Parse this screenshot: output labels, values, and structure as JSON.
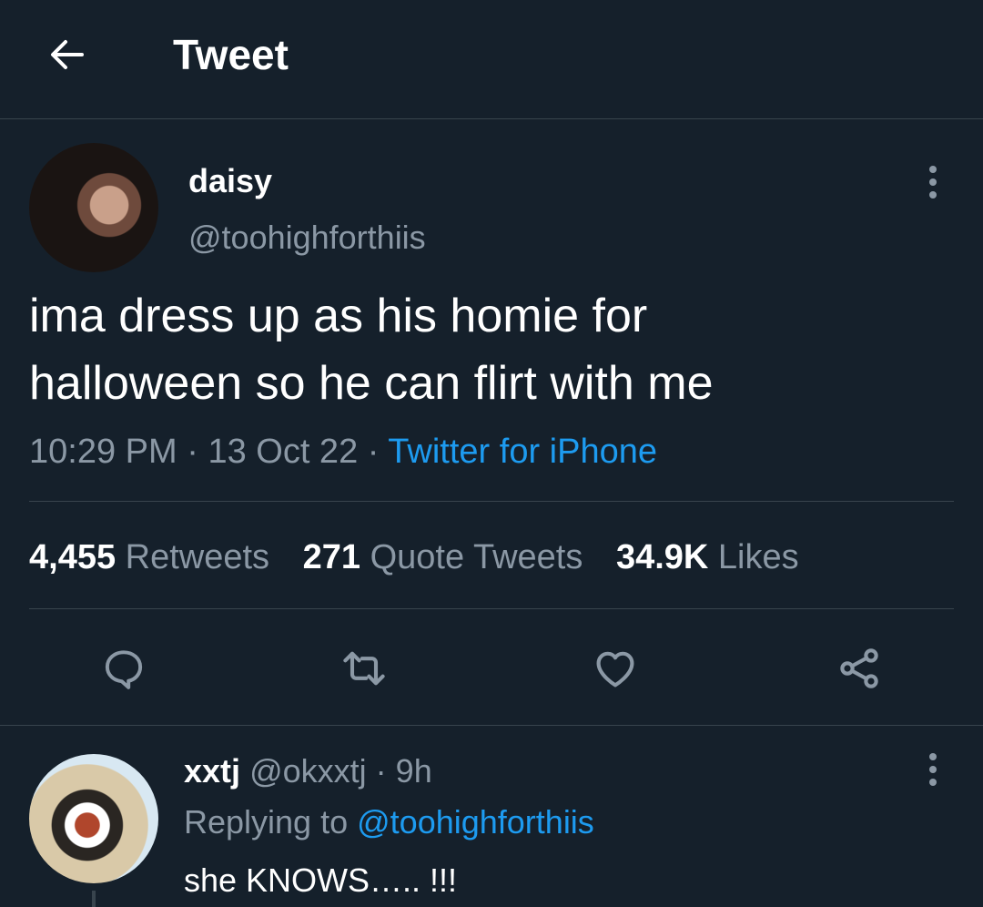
{
  "header": {
    "title": "Tweet",
    "back_icon": "arrow-left-icon"
  },
  "tweet": {
    "author_name": "daisy",
    "author_handle": "@toohighforthiis",
    "text": "ima dress up as his homie for\nhalloween so he can flirt with me",
    "time": "10:29 PM",
    "date": "13 Oct 22",
    "separator": "·",
    "source": "Twitter for iPhone",
    "stats": {
      "retweets_count": "4,455",
      "retweets_label": "Retweets",
      "quotes_count": "271",
      "quotes_label": "Quote Tweets",
      "likes_count": "34.9K",
      "likes_label": "Likes"
    },
    "actions": [
      "reply-icon",
      "retweet-icon",
      "like-icon",
      "share-icon"
    ],
    "more_icon": "more-vertical-icon"
  },
  "reply": {
    "author_name": "xxtj",
    "author_handle": "@okxxtj",
    "separator": "·",
    "age": "9h",
    "replying_prefix": "Replying to",
    "replying_to": "@toohighforthiis",
    "text": "she KNOWS….. !!!",
    "more_icon": "more-vertical-icon"
  },
  "colors": {
    "background": "#15202b",
    "accent": "#1d9bf0",
    "secondary_text": "#8b98a5",
    "divider": "#38444d"
  }
}
